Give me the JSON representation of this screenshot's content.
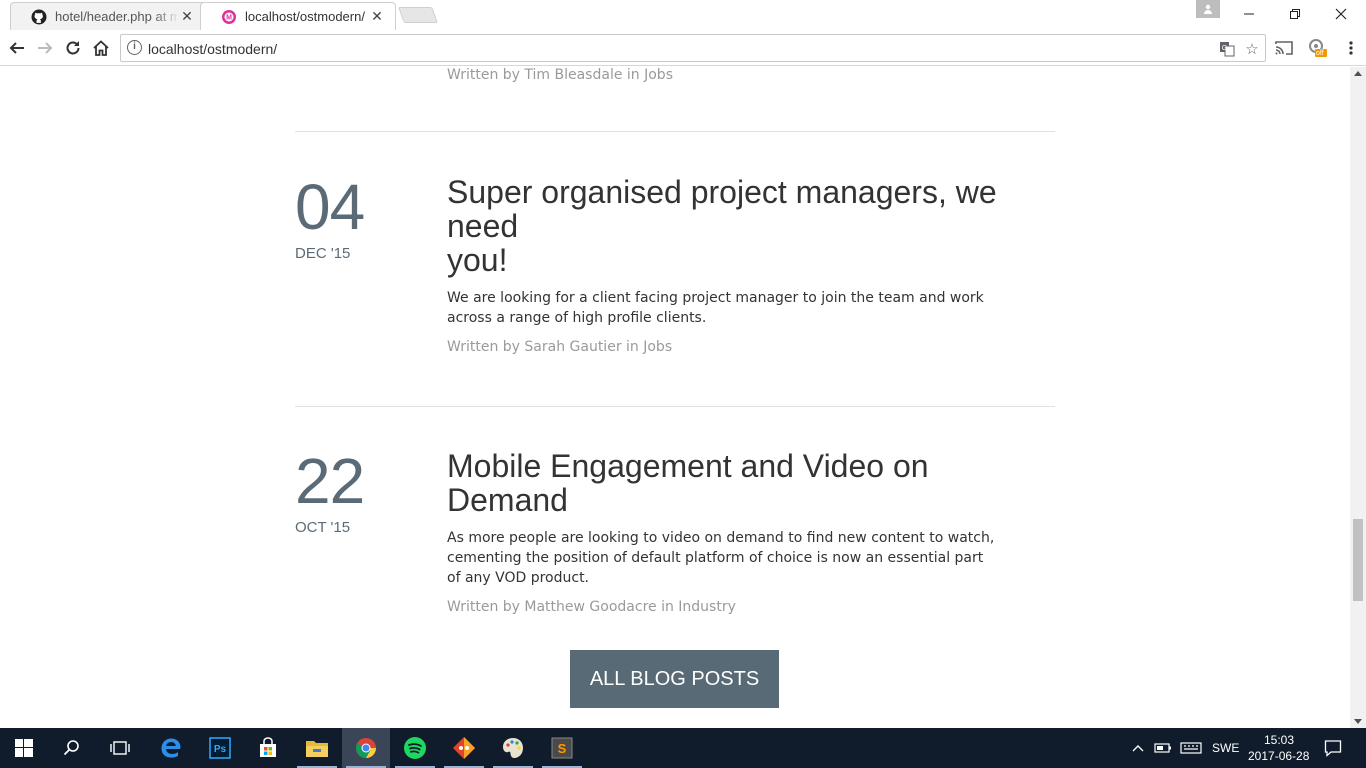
{
  "browser": {
    "tabs": [
      {
        "title": "hotel/header.php at mas",
        "icon": "github-icon",
        "active": false
      },
      {
        "title": "localhost/ostmodern/",
        "icon": "localhost-favicon",
        "active": true
      }
    ],
    "url": "localhost/ostmodern/",
    "extension_badge": "off"
  },
  "page": {
    "previous_post_byline": "Written by Tim Bleasdale in Jobs",
    "posts": [
      {
        "day": "04",
        "month": "DEC '15",
        "title_line1": "Super organised project managers, we",
        "title_line2": "need",
        "title_line3": "you!",
        "excerpt_line1": "We are looking for a client facing project manager to join the team and work",
        "excerpt_line2": "across a range of high profile clients.",
        "byline": "Written by Sarah Gautier in Jobs"
      },
      {
        "day": "22",
        "month": "OCT '15",
        "title_line1": "Mobile Engagement and Video on",
        "title_line2": "Demand",
        "excerpt_line1": "As more people are looking to video on demand to find new content to watch,",
        "excerpt_line2": "cementing the position of default platform of choice is now an essential part",
        "excerpt_line3": "of any VOD product.",
        "byline": "Written by Matthew Goodacre in Industry"
      }
    ],
    "all_posts_button": "ALL BLOG POSTS"
  },
  "taskbar": {
    "language": "SWE",
    "time": "15:03",
    "date": "2017-06-28"
  },
  "colors": {
    "accent": "#586a76",
    "date_text": "#5a6b77",
    "meta_text": "#9a9a9a",
    "taskbar": "#101c2c"
  }
}
